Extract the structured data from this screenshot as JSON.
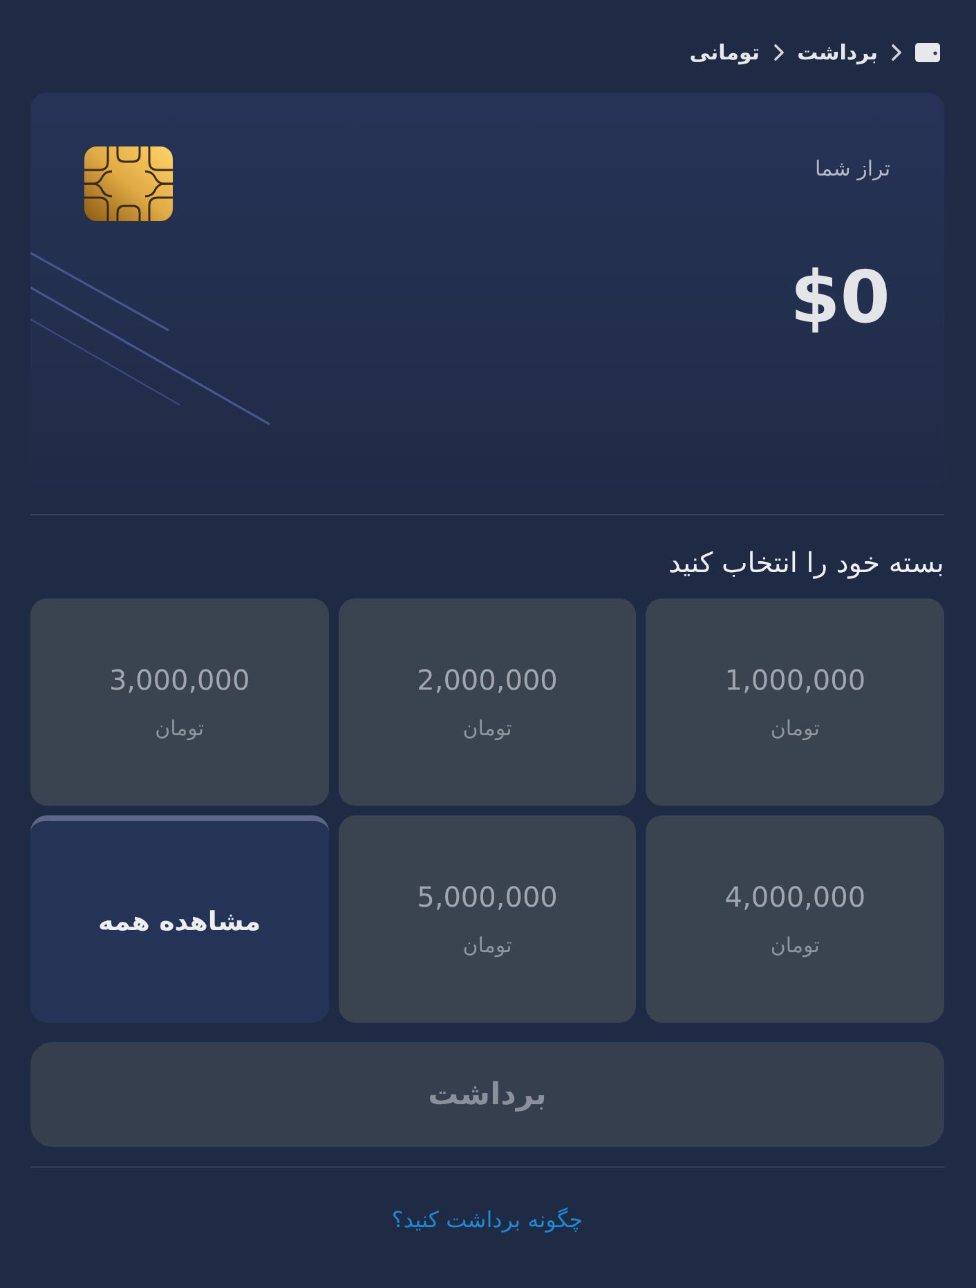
{
  "breadcrumb": {
    "items": [
      {
        "label": "برداشت"
      },
      {
        "label": "تومانی"
      }
    ]
  },
  "balance_card": {
    "label": "تراز شما",
    "amount": "$0"
  },
  "packages": {
    "title": "بسته خود را انتخاب کنید",
    "items": [
      {
        "kind": "package",
        "amount": "1,000,000",
        "unit": "تومان",
        "selected": false
      },
      {
        "kind": "package",
        "amount": "2,000,000",
        "unit": "تومان",
        "selected": false
      },
      {
        "kind": "package",
        "amount": "3,000,000",
        "unit": "تومان",
        "selected": false
      },
      {
        "kind": "package",
        "amount": "4,000,000",
        "unit": "تومان",
        "selected": false
      },
      {
        "kind": "package",
        "amount": "5,000,000",
        "unit": "تومان",
        "selected": false
      },
      {
        "kind": "view_all",
        "label": "مشاهده همه"
      }
    ]
  },
  "withdraw_button": {
    "label": "برداشت",
    "disabled": true
  },
  "help_link": {
    "label": "چگونه برداشت کنید؟"
  }
}
